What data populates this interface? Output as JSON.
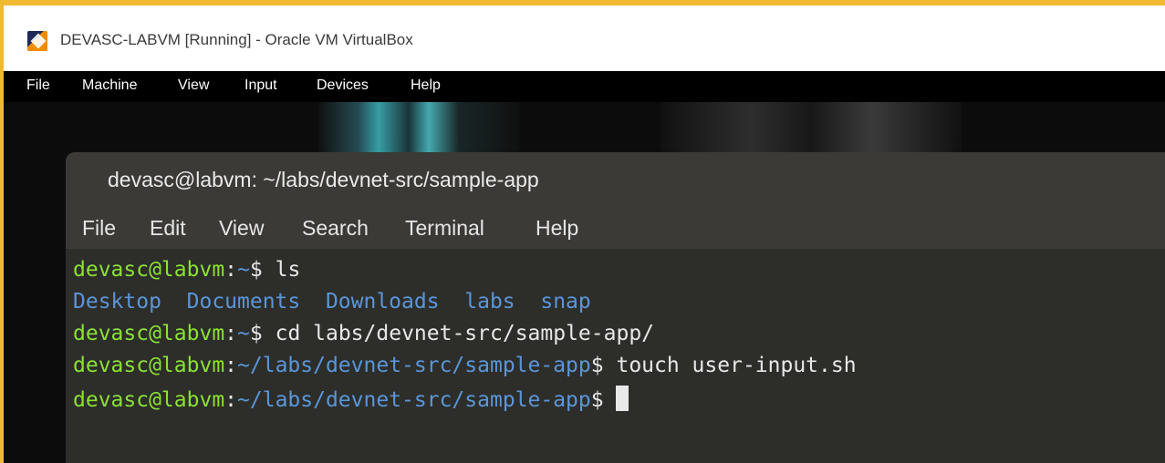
{
  "window": {
    "title": "DEVASC-LABVM [Running] - Oracle VM VirtualBox",
    "icon": "virtualbox-logo-icon"
  },
  "vbox_menu": [
    "File",
    "Machine",
    "View",
    "Input",
    "Devices",
    "Help"
  ],
  "terminal": {
    "title": "devasc@labvm: ~/labs/devnet-src/sample-app",
    "menu": [
      "File",
      "Edit",
      "View",
      "Search",
      "Terminal",
      "Help"
    ],
    "lines": [
      {
        "user": "devasc@labvm",
        "path": "~",
        "prompt": "$",
        "command": " ls"
      },
      {
        "output": "Desktop  Documents  Downloads  labs  snap"
      },
      {
        "user": "devasc@labvm",
        "path": "~",
        "prompt": "$",
        "command": " cd labs/devnet-src/sample-app/"
      },
      {
        "user": "devasc@labvm",
        "path": "~/labs/devnet-src/sample-app",
        "prompt": "$",
        "command": " touch user-input.sh"
      },
      {
        "user": "devasc@labvm",
        "path": "~/labs/devnet-src/sample-app",
        "prompt": "$",
        "command": " "
      }
    ],
    "colors": {
      "prompt_user": "#8ae234",
      "path": "#5a96d8",
      "text": "#e8e8e8",
      "background": "#2d2d2a"
    }
  }
}
